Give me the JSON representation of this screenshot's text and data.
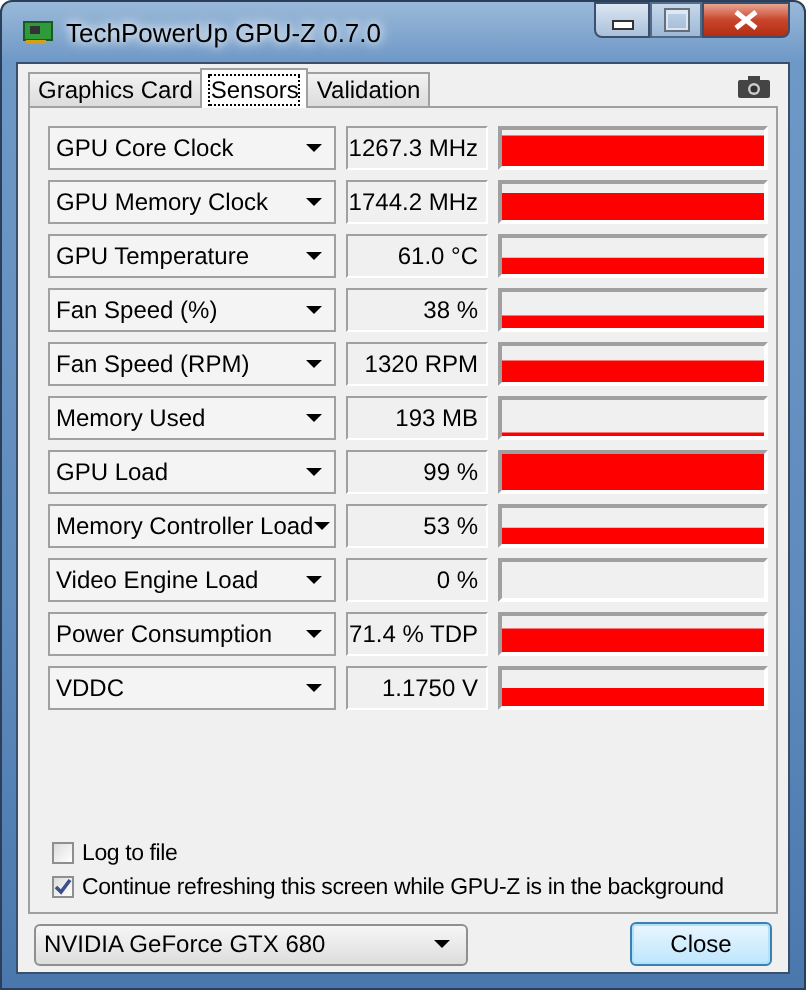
{
  "window": {
    "title": "TechPowerUp GPU-Z 0.7.0"
  },
  "tabs": [
    {
      "label": "Graphics Card",
      "selected": false
    },
    {
      "label": "Sensors",
      "selected": true
    },
    {
      "label": "Validation",
      "selected": false
    }
  ],
  "sensors": [
    {
      "name": "GPU Core Clock",
      "reading": "1267.3 MHz"
    },
    {
      "name": "GPU Memory Clock",
      "reading": "1744.2 MHz"
    },
    {
      "name": "GPU Temperature",
      "reading": "61.0 °C"
    },
    {
      "name": "Fan Speed (%)",
      "reading": "38 %"
    },
    {
      "name": "Fan Speed (RPM)",
      "reading": "1320 RPM"
    },
    {
      "name": "Memory Used",
      "reading": "193 MB"
    },
    {
      "name": "GPU Load",
      "reading": "99 %"
    },
    {
      "name": "Memory Controller Load",
      "reading": "53 %"
    },
    {
      "name": "Video Engine Load",
      "reading": "0 %"
    },
    {
      "name": "Power Consumption",
      "reading": "71.4 % TDP"
    },
    {
      "name": "VDDC",
      "reading": "1.1750 V"
    }
  ],
  "options": [
    {
      "label": "Log to file",
      "checked": false
    },
    {
      "label": "Continue refreshing this screen while GPU-Z is in the background",
      "checked": true
    }
  ],
  "gpu_select": {
    "value": "NVIDIA GeForce GTX 680"
  },
  "close_button": "Close"
}
